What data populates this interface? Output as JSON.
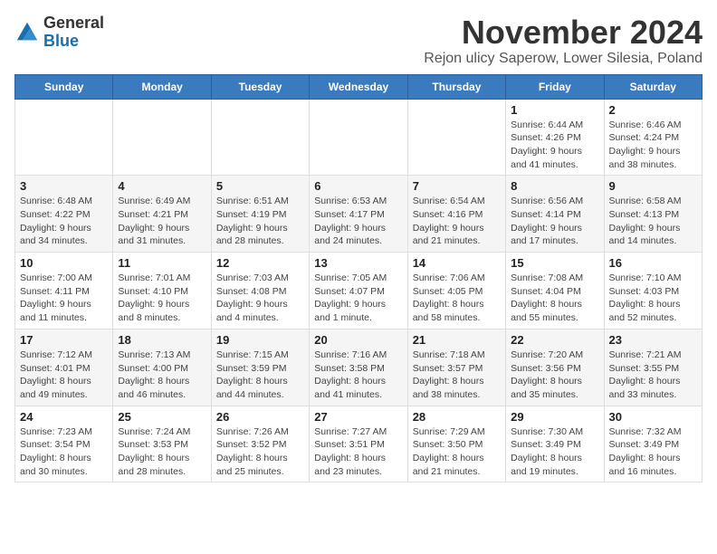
{
  "logo": {
    "general": "General",
    "blue": "Blue"
  },
  "header": {
    "month_title": "November 2024",
    "subtitle": "Rejon ulicy Saperow, Lower Silesia, Poland"
  },
  "weekdays": [
    "Sunday",
    "Monday",
    "Tuesday",
    "Wednesday",
    "Thursday",
    "Friday",
    "Saturday"
  ],
  "weeks": [
    [
      {
        "day": "",
        "info": ""
      },
      {
        "day": "",
        "info": ""
      },
      {
        "day": "",
        "info": ""
      },
      {
        "day": "",
        "info": ""
      },
      {
        "day": "",
        "info": ""
      },
      {
        "day": "1",
        "info": "Sunrise: 6:44 AM\nSunset: 4:26 PM\nDaylight: 9 hours and 41 minutes."
      },
      {
        "day": "2",
        "info": "Sunrise: 6:46 AM\nSunset: 4:24 PM\nDaylight: 9 hours and 38 minutes."
      }
    ],
    [
      {
        "day": "3",
        "info": "Sunrise: 6:48 AM\nSunset: 4:22 PM\nDaylight: 9 hours and 34 minutes."
      },
      {
        "day": "4",
        "info": "Sunrise: 6:49 AM\nSunset: 4:21 PM\nDaylight: 9 hours and 31 minutes."
      },
      {
        "day": "5",
        "info": "Sunrise: 6:51 AM\nSunset: 4:19 PM\nDaylight: 9 hours and 28 minutes."
      },
      {
        "day": "6",
        "info": "Sunrise: 6:53 AM\nSunset: 4:17 PM\nDaylight: 9 hours and 24 minutes."
      },
      {
        "day": "7",
        "info": "Sunrise: 6:54 AM\nSunset: 4:16 PM\nDaylight: 9 hours and 21 minutes."
      },
      {
        "day": "8",
        "info": "Sunrise: 6:56 AM\nSunset: 4:14 PM\nDaylight: 9 hours and 17 minutes."
      },
      {
        "day": "9",
        "info": "Sunrise: 6:58 AM\nSunset: 4:13 PM\nDaylight: 9 hours and 14 minutes."
      }
    ],
    [
      {
        "day": "10",
        "info": "Sunrise: 7:00 AM\nSunset: 4:11 PM\nDaylight: 9 hours and 11 minutes."
      },
      {
        "day": "11",
        "info": "Sunrise: 7:01 AM\nSunset: 4:10 PM\nDaylight: 9 hours and 8 minutes."
      },
      {
        "day": "12",
        "info": "Sunrise: 7:03 AM\nSunset: 4:08 PM\nDaylight: 9 hours and 4 minutes."
      },
      {
        "day": "13",
        "info": "Sunrise: 7:05 AM\nSunset: 4:07 PM\nDaylight: 9 hours and 1 minute."
      },
      {
        "day": "14",
        "info": "Sunrise: 7:06 AM\nSunset: 4:05 PM\nDaylight: 8 hours and 58 minutes."
      },
      {
        "day": "15",
        "info": "Sunrise: 7:08 AM\nSunset: 4:04 PM\nDaylight: 8 hours and 55 minutes."
      },
      {
        "day": "16",
        "info": "Sunrise: 7:10 AM\nSunset: 4:03 PM\nDaylight: 8 hours and 52 minutes."
      }
    ],
    [
      {
        "day": "17",
        "info": "Sunrise: 7:12 AM\nSunset: 4:01 PM\nDaylight: 8 hours and 49 minutes."
      },
      {
        "day": "18",
        "info": "Sunrise: 7:13 AM\nSunset: 4:00 PM\nDaylight: 8 hours and 46 minutes."
      },
      {
        "day": "19",
        "info": "Sunrise: 7:15 AM\nSunset: 3:59 PM\nDaylight: 8 hours and 44 minutes."
      },
      {
        "day": "20",
        "info": "Sunrise: 7:16 AM\nSunset: 3:58 PM\nDaylight: 8 hours and 41 minutes."
      },
      {
        "day": "21",
        "info": "Sunrise: 7:18 AM\nSunset: 3:57 PM\nDaylight: 8 hours and 38 minutes."
      },
      {
        "day": "22",
        "info": "Sunrise: 7:20 AM\nSunset: 3:56 PM\nDaylight: 8 hours and 35 minutes."
      },
      {
        "day": "23",
        "info": "Sunrise: 7:21 AM\nSunset: 3:55 PM\nDaylight: 8 hours and 33 minutes."
      }
    ],
    [
      {
        "day": "24",
        "info": "Sunrise: 7:23 AM\nSunset: 3:54 PM\nDaylight: 8 hours and 30 minutes."
      },
      {
        "day": "25",
        "info": "Sunrise: 7:24 AM\nSunset: 3:53 PM\nDaylight: 8 hours and 28 minutes."
      },
      {
        "day": "26",
        "info": "Sunrise: 7:26 AM\nSunset: 3:52 PM\nDaylight: 8 hours and 25 minutes."
      },
      {
        "day": "27",
        "info": "Sunrise: 7:27 AM\nSunset: 3:51 PM\nDaylight: 8 hours and 23 minutes."
      },
      {
        "day": "28",
        "info": "Sunrise: 7:29 AM\nSunset: 3:50 PM\nDaylight: 8 hours and 21 minutes."
      },
      {
        "day": "29",
        "info": "Sunrise: 7:30 AM\nSunset: 3:49 PM\nDaylight: 8 hours and 19 minutes."
      },
      {
        "day": "30",
        "info": "Sunrise: 7:32 AM\nSunset: 3:49 PM\nDaylight: 8 hours and 16 minutes."
      }
    ]
  ]
}
